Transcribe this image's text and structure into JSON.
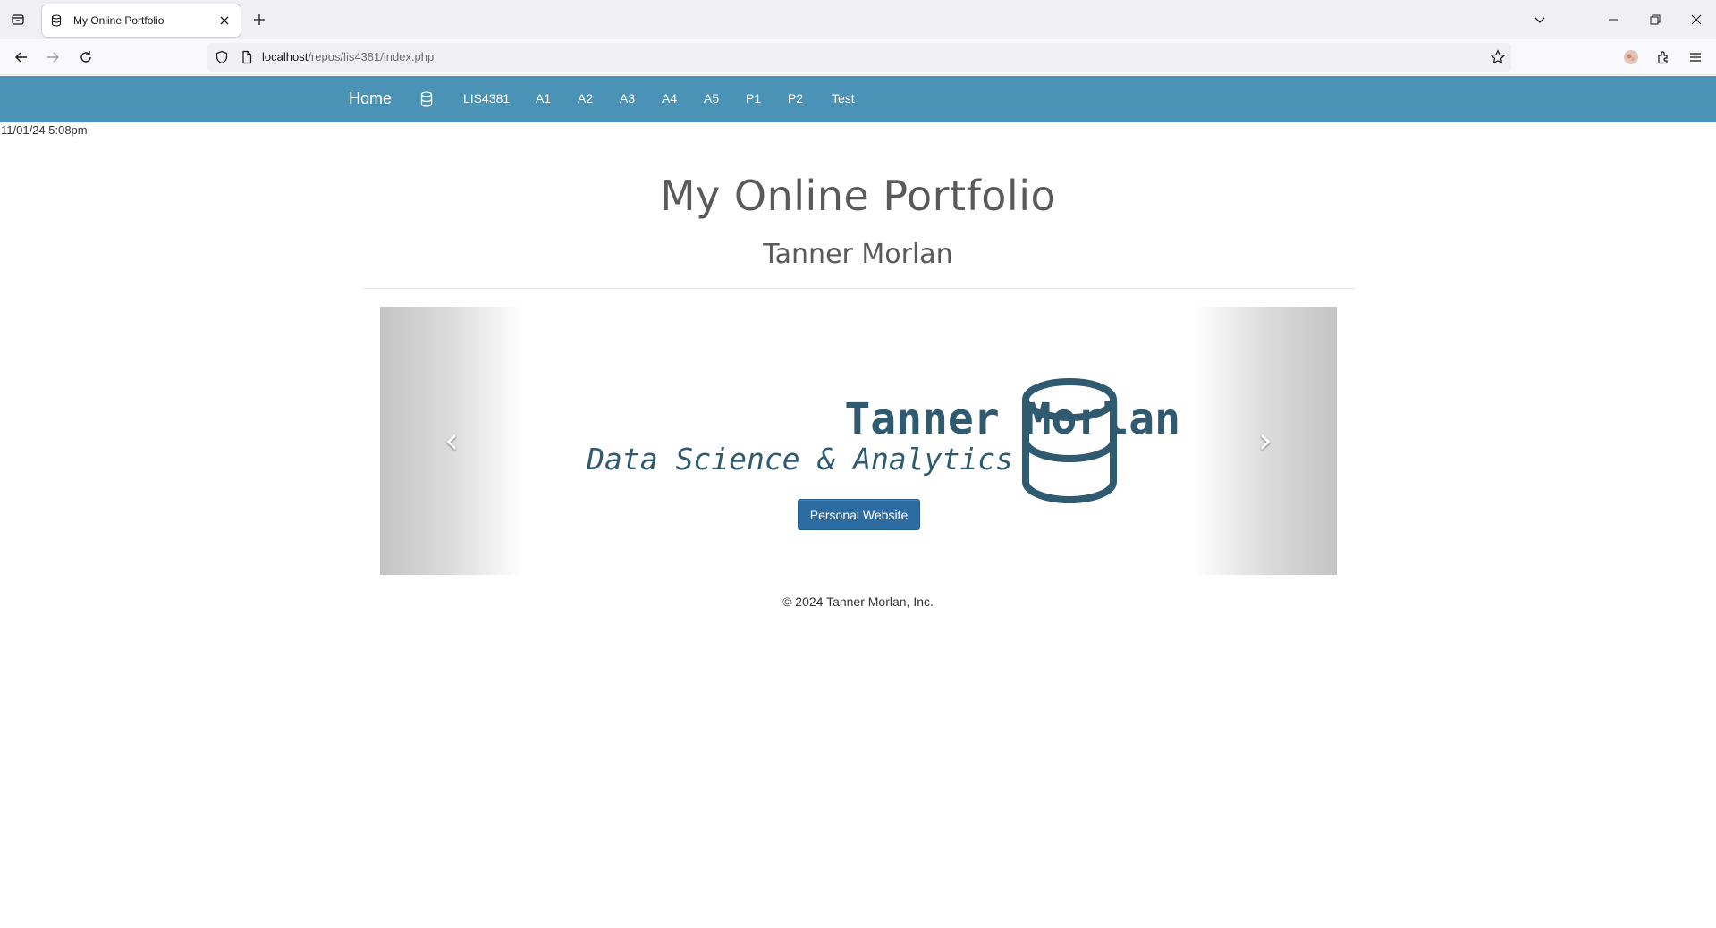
{
  "browser": {
    "tab_title": "My Online Portfolio",
    "url_host": "localhost",
    "url_path": "/repos/lis4381/index.php"
  },
  "site_nav": {
    "brand": "Home",
    "links": [
      "LIS4381",
      "A1",
      "A2",
      "A3",
      "A4",
      "A5",
      "P1",
      "P2",
      "Test"
    ]
  },
  "datetime": "11/01/24 5:08pm",
  "header": {
    "title": "My Online Portfolio",
    "subtitle": "Tanner Morlan"
  },
  "carousel": {
    "name": "Tanner Morlan",
    "tagline": "Data Science & Analytics",
    "button_label": "Personal Website",
    "prev_glyph": "‹",
    "next_glyph": "›"
  },
  "footer": {
    "copyright": "© 2024 Tanner Morlan, Inc."
  },
  "colors": {
    "nav_bg": "#4a93b6",
    "brand_text": "#2f5a70",
    "button_bg": "#2d6ba3"
  }
}
